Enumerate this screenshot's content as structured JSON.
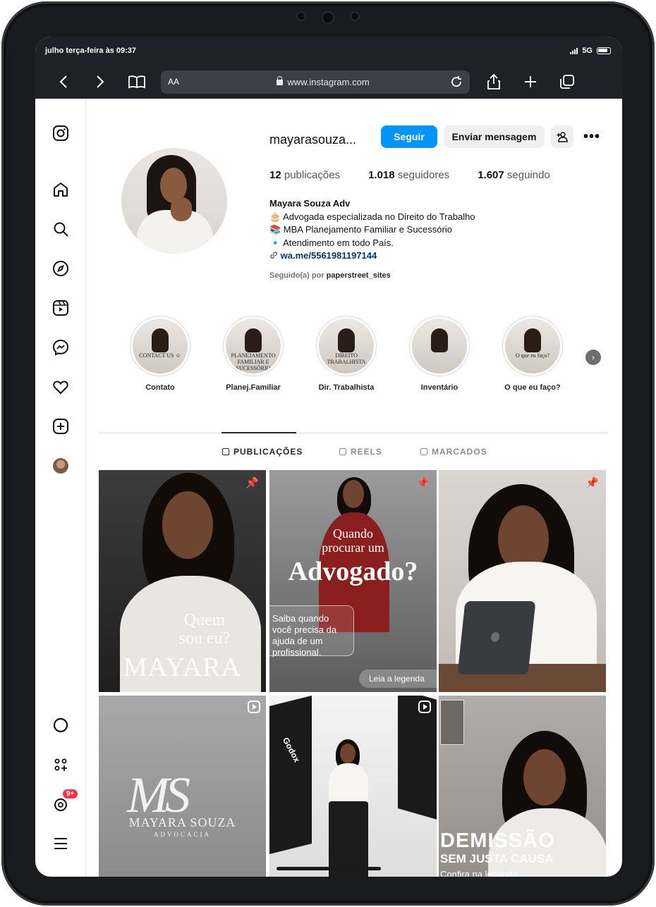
{
  "status": {
    "time": "julho terça-feira às 09:37",
    "network": "5G"
  },
  "browser": {
    "aa": "AA",
    "url": "www.instagram.com"
  },
  "profile": {
    "username": "mayarasouza...",
    "follow_label": "Seguir",
    "message_label": "Enviar mensagem",
    "stats": {
      "posts_count": "12",
      "posts_label": "publicações",
      "followers_count": "1.018",
      "followers_label": "seguidores",
      "following_count": "1.607",
      "following_label": "seguindo"
    },
    "bio": {
      "name": "Mayara Souza Adv",
      "line1": "🎂 Advogada especializada no Direito do Trabalho",
      "line2": "📚 MBA Planejamento Familiar e Sucessório",
      "line3": "🔹 Atendimento em todo País.",
      "link": "wa.me/5561981197144"
    },
    "followed_by_prefix": "Seguido(a) por",
    "followed_by_user": "paperstreet_sites"
  },
  "highlights": [
    {
      "label": "Contato",
      "thumb_text": "CONTACT US ☺"
    },
    {
      "label": "Planej.Familiar",
      "thumb_text": "PLANEJAMENTO FAMILIAR E SUCESSÓRIO"
    },
    {
      "label": "Dir. Trabalhista",
      "thumb_text": "DIREITO TRABALHISTA"
    },
    {
      "label": "Inventário",
      "thumb_text": ""
    },
    {
      "label": "O que eu faço?",
      "thumb_text": "O que eu faço?"
    }
  ],
  "tabs": {
    "posts": "PUBLICAÇÕES",
    "reels": "REELS",
    "tagged": "MARCADOS"
  },
  "posts": {
    "p1": {
      "line1": "Quem",
      "line2": "sou eu?",
      "line3": "MAYARA"
    },
    "p2": {
      "line1": "Quando",
      "line2": "procurar um",
      "line3": "Advogado?",
      "caption": "Saiba quando você precisa da ajuda de um profissional.",
      "cta": "Leia a legenda"
    },
    "p4": {
      "logo": "MS",
      "name": "MAYARA SOUZA",
      "sub": "ADVOCACIA"
    },
    "p5": {
      "brand": "Godox"
    },
    "p6": {
      "title": "DEMISSÃO",
      "sub": "SEM JUSTA CAUSA",
      "small": "Confira na legenda:"
    }
  },
  "sidebar": {
    "notif_badge": "9+"
  },
  "colors": {
    "accent": "#0095f6",
    "badge": "#ff3040",
    "frame": "#1a1b1e"
  }
}
